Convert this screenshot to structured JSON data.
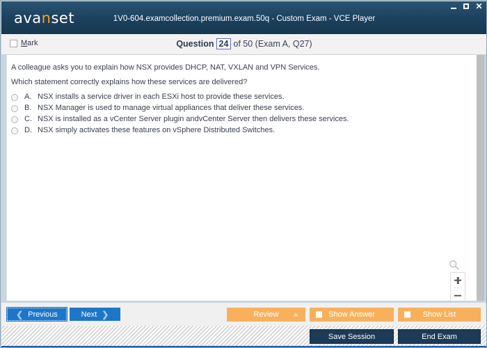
{
  "window": {
    "title": "1V0-604.examcollection.premium.exam.50q - Custom Exam - VCE Player",
    "logo_part1": "ava",
    "logo_accent": "n",
    "logo_part2": "set",
    "controls": {
      "minimize": "minimize-icon",
      "maximize": "maximize-icon",
      "close": "✕"
    },
    "accent_color": "#f5a423",
    "titlebar_color": "#1d4260"
  },
  "question_header": {
    "mark_label_prefix": "M",
    "mark_label_rest": "ark",
    "mark_checked": false,
    "counter_word": "Question",
    "counter_number": "24",
    "counter_rest": "of 50 (Exam A, Q27)"
  },
  "question": {
    "line1": "A colleague asks you to explain how NSX provides DHCP, NAT, VXLAN and VPN Services.",
    "line2": "Which statement correctly explains how these services are delivered?",
    "options": [
      {
        "letter": "A.",
        "text": "NSX installs a service driver in each ESXi host to provide these services.",
        "selected": false
      },
      {
        "letter": "B.",
        "text": "NSX Manager is used to manage virtual appliances that deliver these services.",
        "selected": false
      },
      {
        "letter": "C.",
        "text": "NSX is installed as a vCenter Server plugin andvCenter Server then delivers these services.",
        "selected": false
      },
      {
        "letter": "D.",
        "text": "NSX simply activates these features on vSphere Distributed Switches.",
        "selected": false
      }
    ]
  },
  "zoom_controls": {
    "magnifier": "magnifier-icon",
    "zoom_in": "+",
    "zoom_out": "−"
  },
  "toolbar": {
    "previous_label": "Previous",
    "previous_arrow": "❮",
    "next_label": "Next",
    "next_arrow": "❯",
    "review_label": "Review",
    "show_answer_label": "Show Answer",
    "show_list_label": "Show List",
    "save_session_label": "Save Session",
    "end_exam_label": "End Exam",
    "orange_color": "#f7b15c",
    "blue_color": "#1d76c8",
    "navy_color": "#1d3a57"
  }
}
